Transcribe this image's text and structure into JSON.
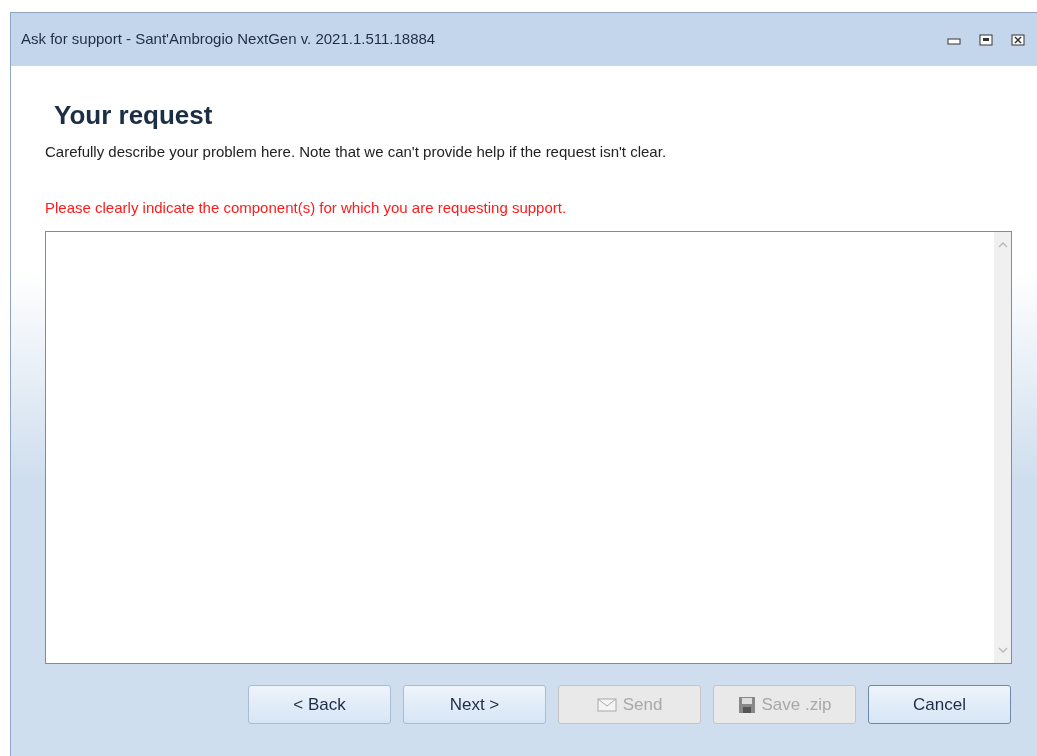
{
  "window": {
    "title": "Ask for support - Sant'Ambrogio NextGen v. 2021.1.511.18884"
  },
  "heading": "Your request",
  "description": "Carefully describe your problem here. Note that we can't provide help if the request isn't clear.",
  "warning": "Please clearly indicate the component(s) for which you are requesting support.",
  "buttons": [
    {
      "label": "< Back",
      "kind": "plain",
      "disabled": false,
      "focused": false
    },
    {
      "label": "Next >",
      "kind": "plain",
      "disabled": false,
      "focused": false
    },
    {
      "label": "Send",
      "kind": "mail",
      "disabled": true
    },
    {
      "label": "Save .zip",
      "kind": "disk",
      "disabled": true
    },
    {
      "label": "Cancel",
      "kind": "plain",
      "disabled": false,
      "focused": true
    }
  ]
}
